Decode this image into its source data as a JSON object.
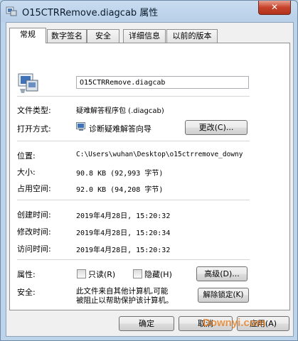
{
  "window": {
    "title": "O15CTRRemove.diagcab 属性",
    "close_glyph": "✕"
  },
  "tabs": [
    {
      "label": "常规"
    },
    {
      "label": "数字签名"
    },
    {
      "label": "安全"
    },
    {
      "label": "详细信息"
    },
    {
      "label": "以前的版本"
    }
  ],
  "general": {
    "file_name": "O15CTRRemove.diagcab",
    "file_type_label": "文件类型:",
    "file_type_value": "疑难解答程序包 (.diagcab)",
    "open_with_label": "打开方式:",
    "open_with_value": "诊断疑难解答向导",
    "change_button": "更改(C)...",
    "location_label": "位置:",
    "location_value": "C:\\Users\\wuhan\\Desktop\\o15ctrremove_downy",
    "size_label": "大小:",
    "size_value": "90.8 KB (92,993 字节)",
    "disk_size_label": "占用空间:",
    "disk_size_value": "92.0 KB (94,208 字节)",
    "created_label": "创建时间:",
    "created_value": "2019年4月28日, 15:20:32",
    "modified_label": "修改时间:",
    "modified_value": "2019年4月28日, 15:20:34",
    "accessed_label": "访问时间:",
    "accessed_value": "2019年4月28日, 15:20:32",
    "attributes_label": "属性:",
    "readonly_label": "只读(R)",
    "hidden_label": "隐藏(H)",
    "advanced_button": "高级(D)...",
    "security_label": "安全:",
    "security_text_line1": "此文件来自其他计算机,可能",
    "security_text_line2": "被阻止以帮助保护该计算机。",
    "unblock_button": "解除锁定(K)"
  },
  "footer": {
    "ok_button": "确定",
    "cancel_button": "取消",
    "apply_button": "应用(A)"
  },
  "watermark": "Downyi.com"
}
